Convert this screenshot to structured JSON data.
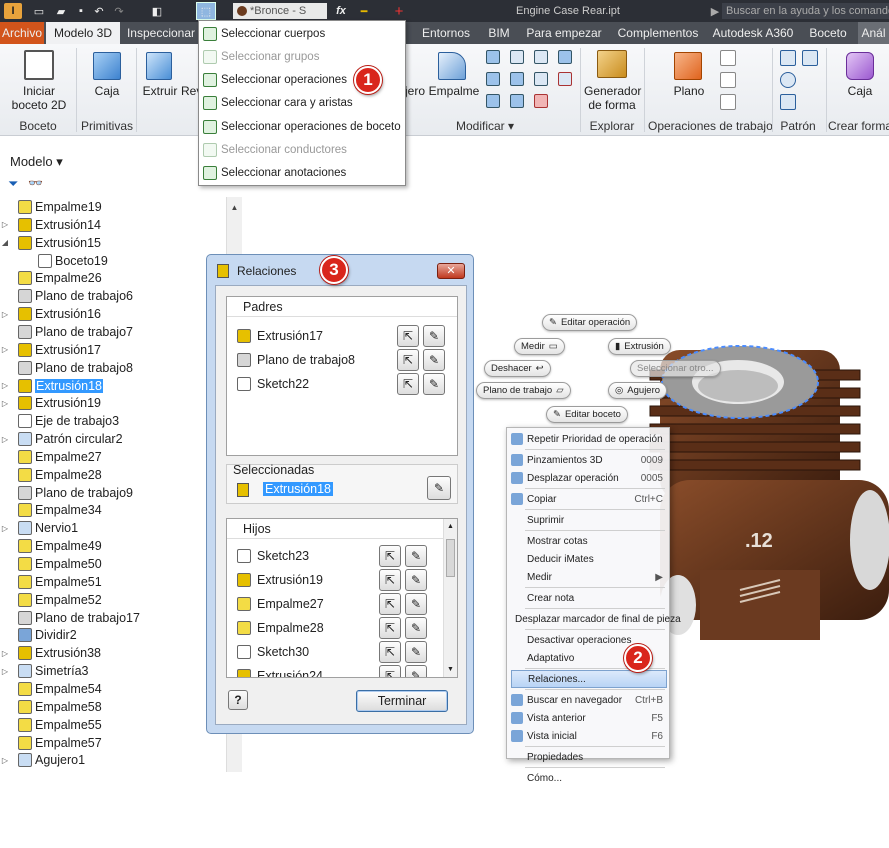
{
  "qat": {
    "bronze": "*Bronce - S",
    "fx": "fx",
    "title": "Engine Case Rear.ipt",
    "help_placeholder": "Buscar en la ayuda y los comandos"
  },
  "tabs": [
    "Archivo",
    "Modelo 3D",
    "Inspeccionar",
    "Entornos",
    "BIM",
    "Para empezar",
    "Complementos",
    "Autodesk A360",
    "Boceto",
    "Anál"
  ],
  "ribbon": {
    "start_sketch": "Iniciar",
    "start_sketch2": "boceto 2D",
    "box": "Caja",
    "extrude": "Extruir",
    "revolve": "Rev",
    "fillet": "Empalme",
    "jero": "jero",
    "shape_generator": "Generador",
    "shape_generator2": "de forma",
    "plane": "Plano",
    "box2": "Caja",
    "groups": {
      "sketch": "Boceto",
      "primitives": "Primitivas",
      "modify": "Modificar",
      "explore": "Explorar",
      "work_features": "Operaciones de trabajo",
      "pattern": "Patrón",
      "create_form": "Crear forma"
    }
  },
  "selection_menu": {
    "items": [
      "Seleccionar cuerpos",
      "Seleccionar grupos",
      "Seleccionar operaciones",
      "Seleccionar cara y aristas",
      "Seleccionar operaciones de boceto",
      "Seleccionar conductores",
      "Seleccionar anotaciones"
    ]
  },
  "browser": {
    "header": "Modelo",
    "items": [
      {
        "label": "Empalme19",
        "t": "fillet"
      },
      {
        "label": "Extrusión14",
        "t": "extrude",
        "tog": "▷"
      },
      {
        "label": "Extrusión15",
        "t": "extrude",
        "tog": "◢"
      },
      {
        "label": "Boceto19",
        "t": "sketch",
        "ind": 1
      },
      {
        "label": "Empalme26",
        "t": "fillet"
      },
      {
        "label": "Plano de trabajo6",
        "t": "plane"
      },
      {
        "label": "Extrusión16",
        "t": "extrude",
        "tog": "▷"
      },
      {
        "label": "Plano de trabajo7",
        "t": "plane"
      },
      {
        "label": "Extrusión17",
        "t": "extrude",
        "tog": "▷"
      },
      {
        "label": "Plano de trabajo8",
        "t": "plane"
      },
      {
        "label": "Extrusión18",
        "t": "extrude",
        "tog": "▷",
        "sel": 1
      },
      {
        "label": "Extrusión19",
        "t": "extrude",
        "tog": "▷"
      },
      {
        "label": "Eje de trabajo3",
        "t": "axis"
      },
      {
        "label": "Patrón circular2",
        "t": "pattern",
        "tog": "▷"
      },
      {
        "label": "Empalme27",
        "t": "fillet"
      },
      {
        "label": "Empalme28",
        "t": "fillet"
      },
      {
        "label": "Plano de trabajo9",
        "t": "plane"
      },
      {
        "label": "Empalme34",
        "t": "fillet"
      },
      {
        "label": "Nervio1",
        "t": "rib",
        "tog": "▷"
      },
      {
        "label": "Empalme49",
        "t": "fillet"
      },
      {
        "label": "Empalme50",
        "t": "fillet"
      },
      {
        "label": "Empalme51",
        "t": "fillet"
      },
      {
        "label": "Empalme52",
        "t": "fillet"
      },
      {
        "label": "Plano de trabajo17",
        "t": "plane"
      },
      {
        "label": "Dividir2",
        "t": "split"
      },
      {
        "label": "Extrusión38",
        "t": "extrude",
        "tog": "▷"
      },
      {
        "label": "Simetría3",
        "t": "mirror",
        "tog": "▷"
      },
      {
        "label": "Empalme54",
        "t": "fillet"
      },
      {
        "label": "Empalme58",
        "t": "fillet"
      },
      {
        "label": "Empalme55",
        "t": "fillet"
      },
      {
        "label": "Empalme57",
        "t": "fillet"
      },
      {
        "label": "Agujero1",
        "t": "hole",
        "tog": "▷"
      }
    ]
  },
  "dialog": {
    "title": "Relaciones",
    "parents_header": "Padres",
    "parents": [
      {
        "label": "Extrusión17",
        "t": "extrude"
      },
      {
        "label": "Plano de trabajo8",
        "t": "plane"
      },
      {
        "label": "Sketch22",
        "t": "sketch"
      }
    ],
    "selected_header": "Seleccionadas",
    "selected": "Extrusión18",
    "children_header": "Hijos",
    "children": [
      {
        "label": "Sketch23",
        "t": "sketch"
      },
      {
        "label": "Extrusión19",
        "t": "extrude"
      },
      {
        "label": "Empalme27",
        "t": "fillet"
      },
      {
        "label": "Empalme28",
        "t": "fillet"
      },
      {
        "label": "Sketch30",
        "t": "sketch"
      },
      {
        "label": "Extrusión24",
        "t": "extrude"
      }
    ],
    "help": "?",
    "finish": "Terminar"
  },
  "markers": {
    "edit_feature": "Editar operación",
    "measure": "Medir",
    "extrude": "Extrusión",
    "undo": "Deshacer",
    "select_other": "Seleccionar otro...",
    "work_plane": "Plano de trabajo",
    "hole": "Agujero",
    "edit_sketch": "Editar boceto"
  },
  "context_menu": {
    "items": [
      {
        "label": "Repetir Prioridad de operación",
        "ic": 1
      },
      {
        "sep": 1
      },
      {
        "label": "Pinzamientos 3D",
        "sc": "0009",
        "ic": 1
      },
      {
        "label": "Desplazar operación",
        "sc": "0005",
        "ic": 1
      },
      {
        "sep": 1
      },
      {
        "label": "Copiar",
        "sc": "Ctrl+C",
        "ic": 1
      },
      {
        "sep": 1
      },
      {
        "label": "Suprimir"
      },
      {
        "sep": 1
      },
      {
        "label": "Mostrar cotas"
      },
      {
        "label": "Deducir iMates"
      },
      {
        "label": "Medir",
        "sc": "▶"
      },
      {
        "sep": 1
      },
      {
        "label": "Crear nota"
      },
      {
        "sep": 1
      },
      {
        "label": "Desplazar marcador de final de pieza",
        "ic": 1
      },
      {
        "sep": 1
      },
      {
        "label": "Desactivar operaciones"
      },
      {
        "label": "Adaptativo"
      },
      {
        "sep": 1
      },
      {
        "label": "Relaciones...",
        "hl": 1
      },
      {
        "sep": 1
      },
      {
        "label": "Buscar en navegador",
        "sc": "Ctrl+B",
        "ic": 1
      },
      {
        "label": "Vista anterior",
        "sc": "F5",
        "ic": 1
      },
      {
        "label": "Vista inicial",
        "sc": "F6",
        "ic": 1
      },
      {
        "sep": 1
      },
      {
        "label": "Propiedades"
      },
      {
        "sep": 1
      },
      {
        "label": "Cómo..."
      }
    ]
  },
  "part_label": ".12",
  "badges": [
    "1",
    "2",
    "3"
  ],
  "colors": {
    "accent_blue": "#3399ff",
    "badge_red": "#d9261c",
    "ribbon_dark": "#2c2f36",
    "file_tab": "#d2541b"
  }
}
